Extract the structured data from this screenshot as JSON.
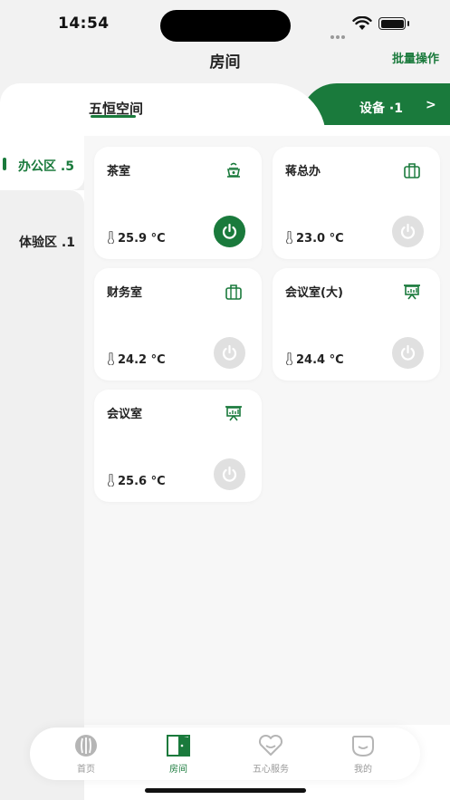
{
  "status_bar": {
    "time": "14:54"
  },
  "nav": {
    "title": "房间",
    "batch_label": "批量操作"
  },
  "tabs": {
    "space_label": "五恒空间",
    "device_label": "设备 ·1",
    "device_arrow": ">"
  },
  "sidebar": {
    "items": [
      {
        "label": "办公区 .5",
        "active": true
      },
      {
        "label": "体验区 .1",
        "active": false
      }
    ]
  },
  "rooms": [
    {
      "name": "茶室",
      "icon": "tea-icon",
      "temp": "25.9 °C",
      "power": "on"
    },
    {
      "name": "蒋总办",
      "icon": "briefcase-icon",
      "temp": "23.0 °C",
      "power": "off"
    },
    {
      "name": "财务室",
      "icon": "briefcase-icon",
      "temp": "24.2 °C",
      "power": "off"
    },
    {
      "name": "会议室(大)",
      "icon": "presentation-icon",
      "temp": "24.4 °C",
      "power": "off"
    },
    {
      "name": "会议室",
      "icon": "presentation-icon",
      "temp": "25.6 °C",
      "power": "off"
    }
  ],
  "tabbar": {
    "items": [
      {
        "label": "首页",
        "icon": "home-icon"
      },
      {
        "label": "房间",
        "icon": "door-icon",
        "active": true
      },
      {
        "label": "五心服务",
        "icon": "heart-icon"
      },
      {
        "label": "我的",
        "icon": "smile-icon"
      }
    ]
  },
  "colors": {
    "accent": "#1a7a3c",
    "off": "#e0e0e0"
  }
}
